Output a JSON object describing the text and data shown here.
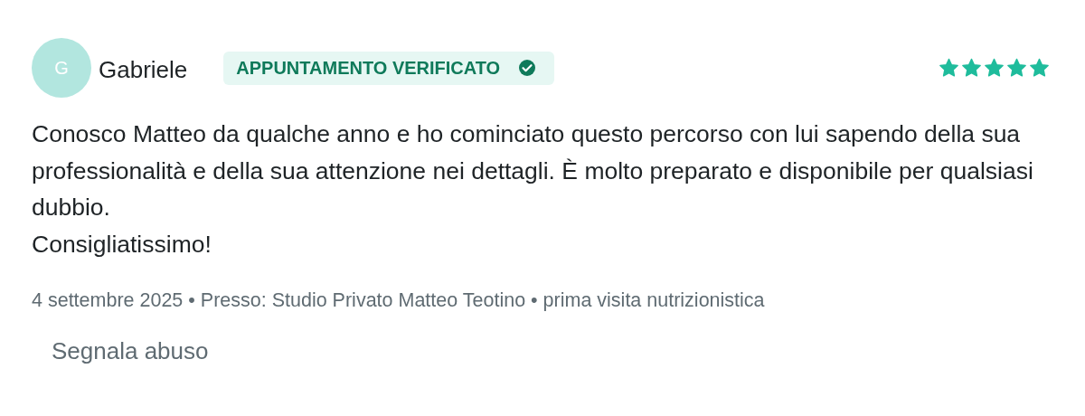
{
  "review": {
    "avatar_initial": "G",
    "author": "Gabriele",
    "badge": "APPUNTAMENTO VERIFICATO",
    "stars": 5,
    "paragraphs": [
      "Conosco Matteo da qualche anno e ho cominciato questo percorso con lui sapendo della sua professionalità e della sua attenzione nei dettagli. È molto preparato e disponibile per qualsiasi dubbio.",
      "Consigliatissimo!"
    ],
    "meta": "4 settembre 2025 • Presso: Studio Privato Matteo Teotino • prima visita nutrizionistica",
    "report_link": "Segnala abuso"
  }
}
